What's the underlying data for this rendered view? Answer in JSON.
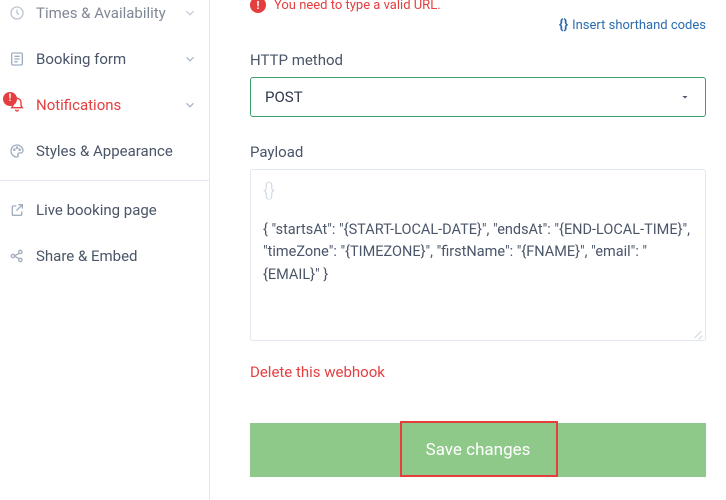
{
  "sidebar": {
    "items": [
      {
        "label": "Times & Availability",
        "icon": "clock-icon",
        "expandable": true
      },
      {
        "label": "Booking form",
        "icon": "form-icon",
        "expandable": true
      },
      {
        "label": "Notifications",
        "icon": "bell-icon",
        "expandable": true,
        "active": true,
        "alert": "!"
      },
      {
        "label": "Styles & Appearance",
        "icon": "palette-icon",
        "expandable": false
      }
    ],
    "bottom": [
      {
        "label": "Live booking page",
        "icon": "external-link-icon"
      },
      {
        "label": "Share & Embed",
        "icon": "share-icon"
      }
    ]
  },
  "main": {
    "error_text": "You need to type a valid URL.",
    "shorthand_link": "Insert shorthand codes",
    "http_method": {
      "label": "HTTP method",
      "value": "POST"
    },
    "payload": {
      "label": "Payload",
      "placeholder_glyph": "{}",
      "value": "{ \"startsAt\": \"{START-LOCAL-DATE}\", \"endsAt\": \"{END-LOCAL-TIME}\", \"timeZone\": \"{TIMEZONE}\", \"firstName\": \"{FNAME}\", \"email\": \"{EMAIL}\" }"
    },
    "delete_link": "Delete this webhook",
    "save_label": "Save changes"
  }
}
